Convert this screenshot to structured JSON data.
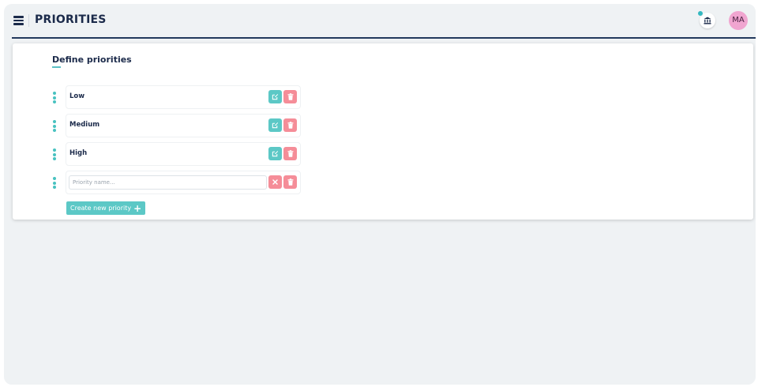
{
  "header": {
    "title": "PRIORITIES",
    "menu_icon": "hamburger-menu-icon",
    "org_icon": "bank-building-icon",
    "avatar_initials": "MA",
    "avatar_color": "#f0a5d0",
    "badge_color": "#34b8c0"
  },
  "card": {
    "title": "Define priorities",
    "priorities": [
      {
        "label": "Low"
      },
      {
        "label": "Medium"
      },
      {
        "label": "High"
      }
    ],
    "new_priority": {
      "value": "",
      "placeholder": "Priority name..."
    },
    "create_button_label": "Create new priority",
    "create_button_icon": "+"
  },
  "colors": {
    "accent_teal": "#5cc8c6",
    "danger_pink": "#f58d98",
    "text_navy": "#1b2a4a"
  }
}
